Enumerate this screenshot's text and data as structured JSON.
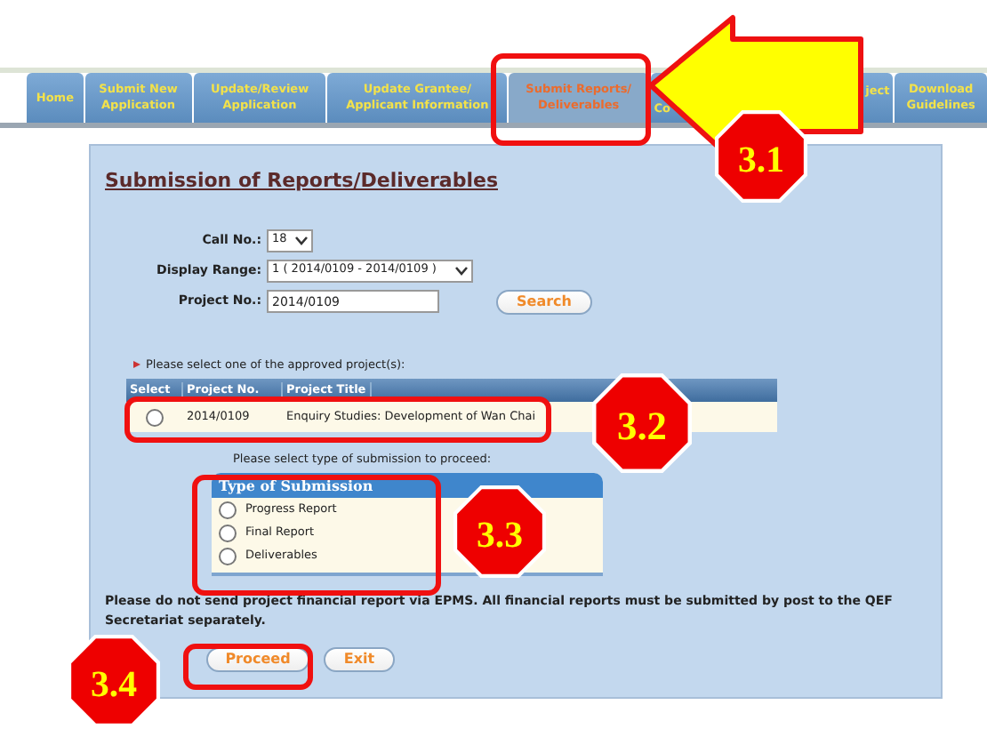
{
  "tabs": [
    {
      "lines": [
        "Home"
      ],
      "selected": false
    },
    {
      "lines": [
        "Submit New",
        "Application"
      ],
      "selected": false
    },
    {
      "lines": [
        "Update/Review",
        "Application"
      ],
      "selected": false
    },
    {
      "lines": [
        "Update Grantee/",
        "Applicant Information"
      ],
      "selected": false
    },
    {
      "lines": [
        "Submit Reports/",
        "Deliverables"
      ],
      "selected": true
    },
    {
      "lines": [
        "Co"
      ],
      "selected": false
    },
    {
      "lines": [
        "ject"
      ],
      "selected": false
    },
    {
      "lines": [
        "Download",
        "Guidelines"
      ],
      "selected": false
    }
  ],
  "page_title": "Submission of Reports/Deliverables",
  "form": {
    "call_no": {
      "label": "Call No.:",
      "value": "18"
    },
    "display_range": {
      "label": "Display Range:",
      "value": "1 ( 2014/0109 - 2014/0109 )"
    },
    "project_no": {
      "label": "Project No.:",
      "value": "2014/0109"
    },
    "search_button": "Search"
  },
  "projects_prompt": "Please select one of the approved project(s):",
  "projects_table": {
    "columns": [
      "Select",
      "Project No.",
      "Project Title"
    ],
    "rows": [
      {
        "selected": false,
        "project_no": "2014/0109",
        "title": "Enquiry Studies: Development of Wan Chai"
      }
    ]
  },
  "submission_prompt": "Please select type of submission to proceed:",
  "submission_types": {
    "title": "Type of Submission",
    "options": [
      {
        "label": "Progress Report",
        "selected": false
      },
      {
        "label": "Final Report",
        "selected": false
      },
      {
        "label": "Deliverables",
        "selected": false
      }
    ]
  },
  "notice": "Please do not send project financial report via EPMS. All financial reports must be submitted by post to the QEF Secretariat separately.",
  "buttons": [
    "Proceed",
    "Exit"
  ],
  "annotations": [
    {
      "label": "3.1"
    },
    {
      "label": "3.2"
    },
    {
      "label": "3.3"
    },
    {
      "label": "3.4"
    }
  ]
}
